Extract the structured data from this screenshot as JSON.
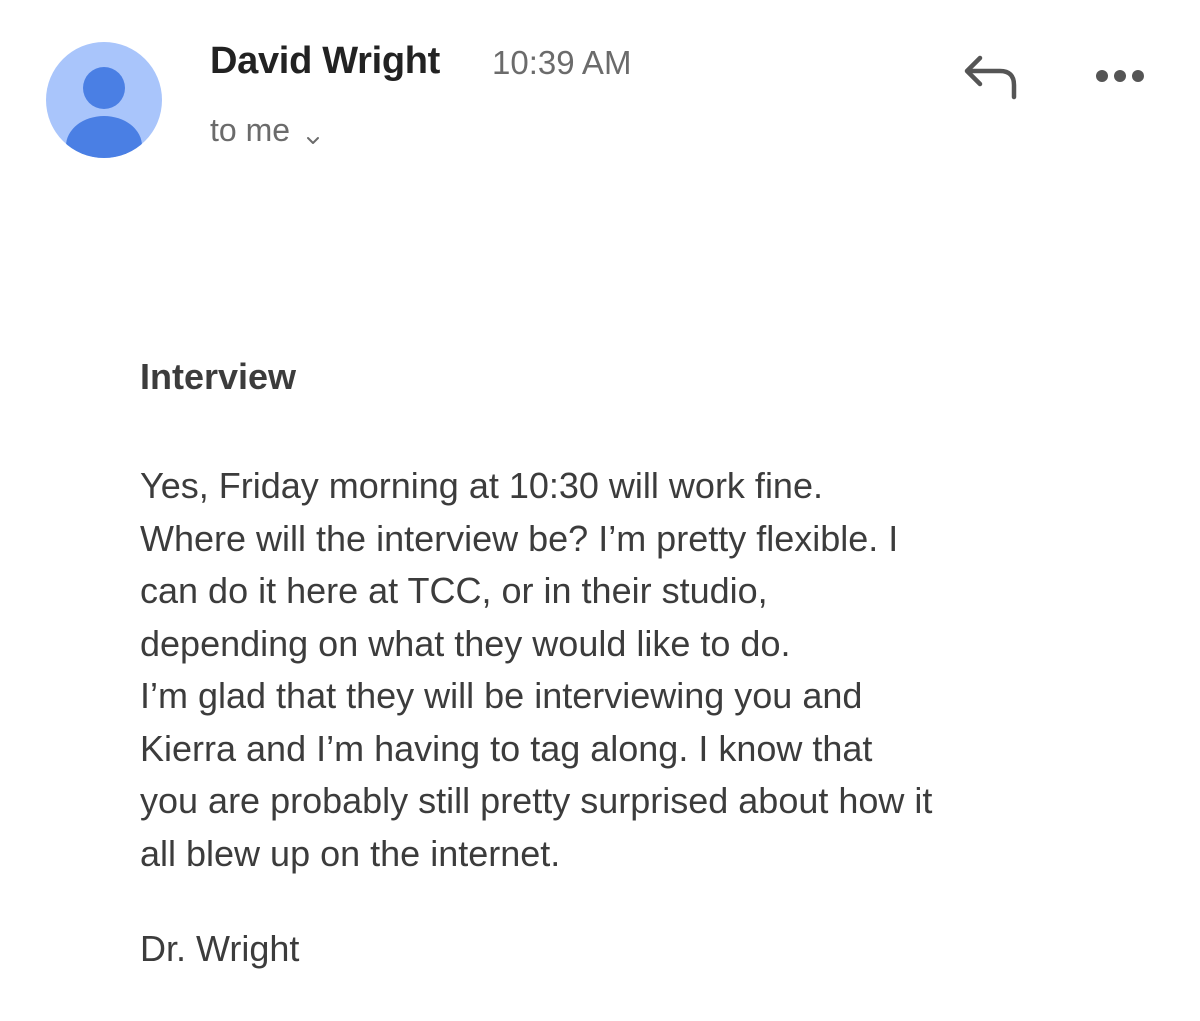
{
  "email": {
    "sender": {
      "name": "David Wright",
      "avatar_icon": "person-icon",
      "avatar_bg": "#a9c5fb",
      "avatar_fg": "#4a7fe4"
    },
    "timestamp": "10:39 AM",
    "recipient_label": "to me",
    "actions": {
      "reply_icon": "reply-icon",
      "more_icon": "more-horizontal-icon"
    },
    "subject": "Interview",
    "body_lines": [
      "Yes, Friday morning at 10:30 will work fine.",
      "Where will the interview be? I’m pretty flexible. I",
      "can do it here at TCC, or in their studio,",
      "depending on what they would like to do.",
      "I’m glad that they will be interviewing you and",
      "Kierra and I’m having to tag along. I know that",
      "you are probably still pretty surprised about how it",
      "all blew up on the internet."
    ],
    "signature": "Dr. Wright"
  }
}
